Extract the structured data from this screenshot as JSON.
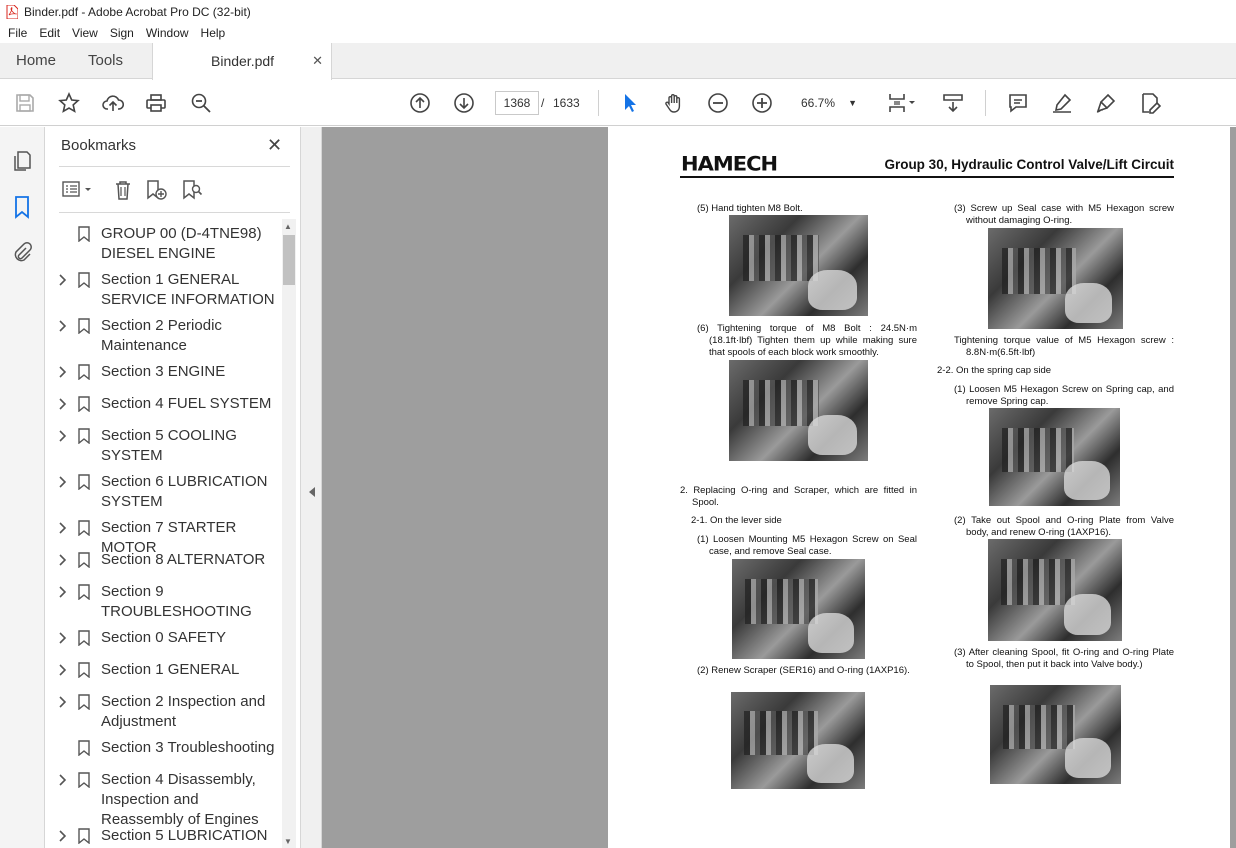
{
  "window": {
    "title": "Binder.pdf - Adobe Acrobat Pro DC (32-bit)"
  },
  "menu": [
    "File",
    "Edit",
    "View",
    "Sign",
    "Window",
    "Help"
  ],
  "tabs": {
    "home": "Home",
    "tools": "Tools",
    "document": "Binder.pdf"
  },
  "toolbar": {
    "current_page": "1368",
    "page_separator": "/",
    "total_pages": "1633",
    "zoom": "66.7%"
  },
  "bookmarks": {
    "title": "Bookmarks",
    "items": [
      {
        "label": "GROUP 00 (D-4TNE98) DIESEL ENGINE",
        "expandable": false
      },
      {
        "label": "Section 1 GENERAL SERVICE INFORMATION",
        "expandable": true
      },
      {
        "label": "Section 2 Periodic Maintenance",
        "expandable": true
      },
      {
        "label": "Section 3 ENGINE",
        "expandable": true
      },
      {
        "label": "Section 4 FUEL SYSTEM",
        "expandable": true
      },
      {
        "label": "Section 5 COOLING SYSTEM",
        "expandable": true
      },
      {
        "label": "Section 6 LUBRICATION SYSTEM",
        "expandable": true
      },
      {
        "label": "Section 7 STARTER MOTOR",
        "expandable": true
      },
      {
        "label": "Section 8 ALTERNATOR",
        "expandable": true
      },
      {
        "label": "Section 9 TROUBLESHOOTING",
        "expandable": true
      },
      {
        "label": "Section 0 SAFETY",
        "expandable": true
      },
      {
        "label": "Section 1 GENERAL",
        "expandable": true
      },
      {
        "label": "Section 2 Inspection and Adjustment",
        "expandable": true
      },
      {
        "label": "Section 3 Troubleshooting",
        "expandable": false
      },
      {
        "label": "Section 4 Disassembly, Inspection and Reassembly of Engines",
        "expandable": true
      },
      {
        "label": "Section 5 LUBRICATION",
        "expandable": true
      }
    ]
  },
  "document": {
    "logo": "HAMECH",
    "header": "Group 30, Hydraulic Control Valve/Lift Circuit",
    "left": {
      "p1": "(5) Hand tighten M8 Bolt.",
      "p2": "(6) Tightening torque of M8 Bolt : 24.5N·m (18.1ft·lbf) Tighten them up while making sure that spools of each block work smoothly.",
      "p3": "2. Replacing O-ring and Scraper, which are fitted in Spool.",
      "p4": "2-1. On the lever side",
      "p5": "(1) Loosen Mounting M5 Hexagon Screw on Seal case, and remove Seal case.",
      "p6": "(2) Renew Scraper (SER16) and O-ring (1AXP16)."
    },
    "right": {
      "p1": "(3) Screw up Seal case with M5 Hexagon screw without damaging O-ring.",
      "p2": "Tightening torque value of M5 Hexagon screw : 8.8N·m(6.5ft·lbf)",
      "p3": "2-2. On the spring cap side",
      "p4": "(1) Loosen M5 Hexagon Screw on Spring cap, and remove Spring cap.",
      "p5": "(2) Take out Spool and O-ring Plate from Valve body, and renew O-ring (1AXP16).",
      "p6": "(3) After cleaning Spool, fit O-ring and O-ring Plate to Spool, then put it back into Valve body.)"
    }
  },
  "colors": {
    "accent_blue": "#1473e6",
    "pdf_red": "#d9261c",
    "viewer_gray": "#9e9e9e"
  }
}
